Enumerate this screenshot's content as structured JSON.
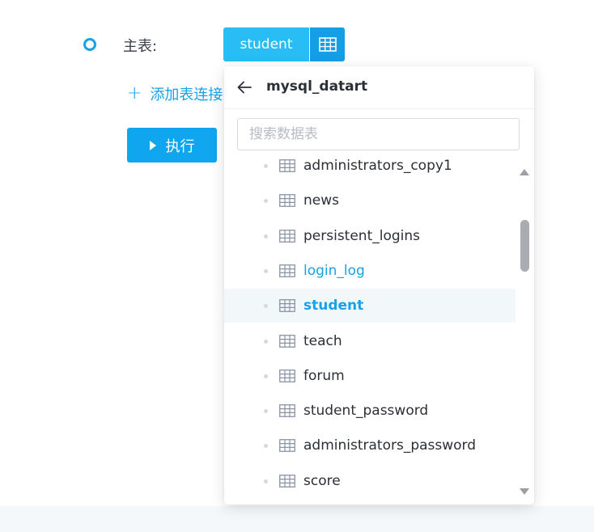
{
  "form": {
    "main_table_label": "主表:",
    "selected_table": "student",
    "add_join_label": "添加表连接",
    "run_label": "执行"
  },
  "dropdown": {
    "title": "mysql_datart",
    "search_placeholder": "搜索数据表",
    "search_value": "",
    "tables": [
      {
        "name": "administrators_copy1",
        "state": "normal"
      },
      {
        "name": "news",
        "state": "normal"
      },
      {
        "name": "persistent_logins",
        "state": "normal"
      },
      {
        "name": "login_log",
        "state": "hover"
      },
      {
        "name": "student",
        "state": "selected"
      },
      {
        "name": "teach",
        "state": "normal"
      },
      {
        "name": "forum",
        "state": "normal"
      },
      {
        "name": "student_password",
        "state": "normal"
      },
      {
        "name": "administrators_password",
        "state": "normal"
      },
      {
        "name": "score",
        "state": "normal"
      }
    ]
  },
  "icons": {
    "back": "arrow-left-icon",
    "table": "table-icon",
    "grid": "grid-icon",
    "run": "play-icon",
    "add": "plus-icon"
  },
  "colors": {
    "accent": "#17a2e8",
    "button_light": "#29bdf5",
    "button_dark": "#149ee6",
    "selected_row_bg": "#f2f7fa"
  }
}
